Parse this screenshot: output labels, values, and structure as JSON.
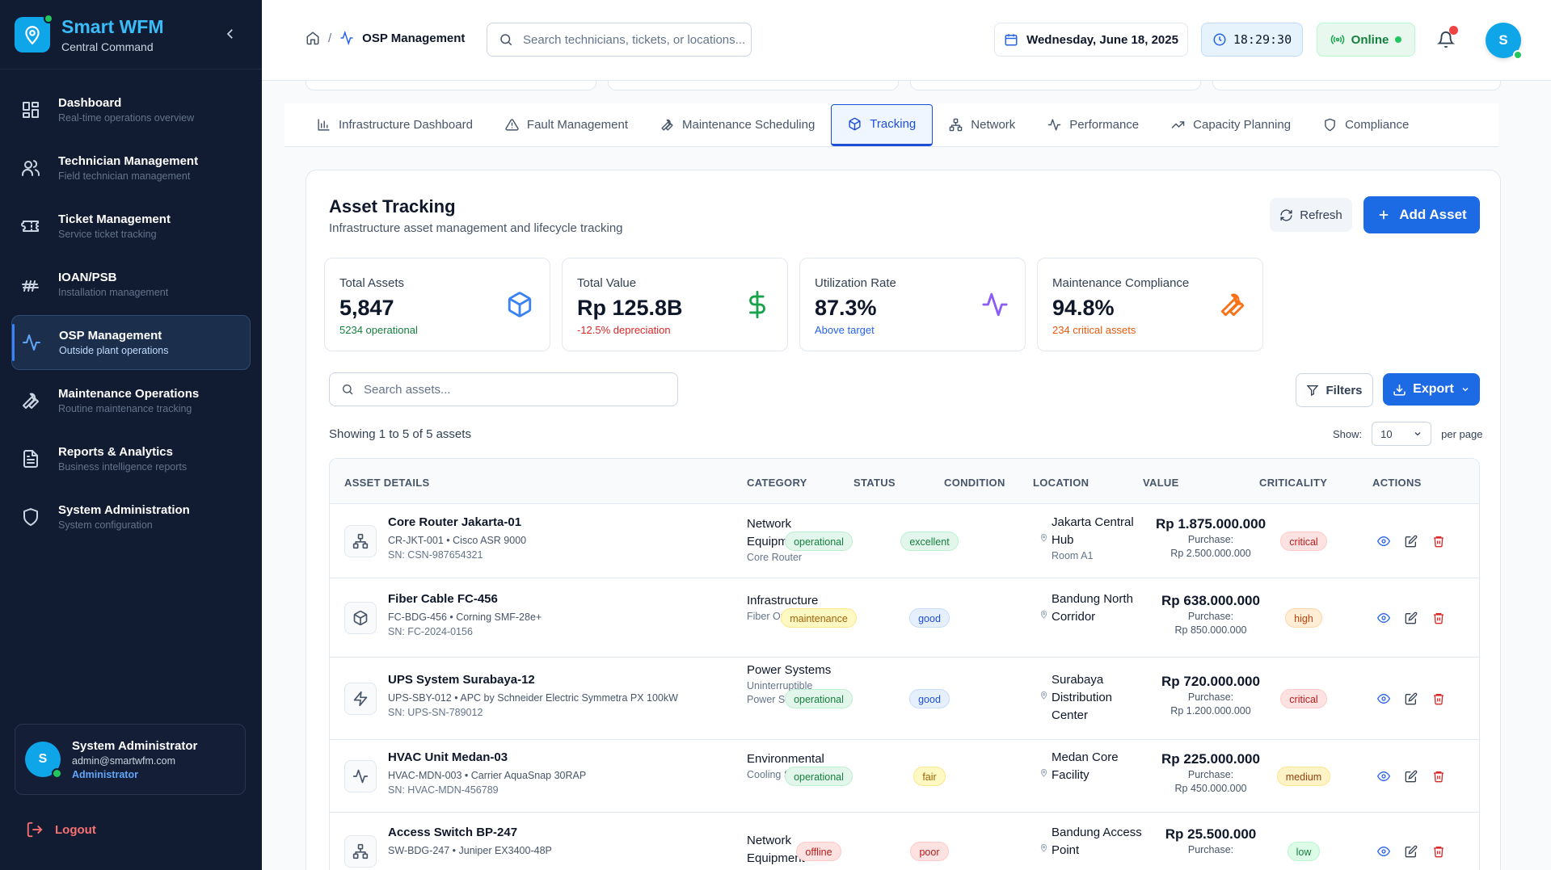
{
  "sidebar": {
    "brand_title": "Smart WFM",
    "brand_subtitle": "Central Command",
    "items": [
      {
        "label": "Dashboard",
        "sub": "Real-time operations overview",
        "icon": "dashboard-icon"
      },
      {
        "label": "Technician Management",
        "sub": "Field technician management",
        "icon": "users-icon"
      },
      {
        "label": "Ticket Management",
        "sub": "Service ticket tracking",
        "icon": "ticket-icon"
      },
      {
        "label": "IOAN/PSB",
        "sub": "Installation management",
        "icon": "signal-icon"
      },
      {
        "label": "OSP Management",
        "sub": "Outside plant operations",
        "icon": "activity-icon",
        "active": true
      },
      {
        "label": "Maintenance Operations",
        "sub": "Routine maintenance tracking",
        "icon": "wrench-icon"
      },
      {
        "label": "Reports & Analytics",
        "sub": "Business intelligence reports",
        "icon": "report-icon"
      },
      {
        "label": "System Administration",
        "sub": "System configuration",
        "icon": "shield-icon"
      }
    ],
    "user": {
      "initial": "S",
      "name": "System Administrator",
      "email": "admin@smartwfm.com",
      "role": "Administrator"
    },
    "logout_label": "Logout"
  },
  "header": {
    "breadcrumb_sep": "/",
    "breadcrumb_current": "OSP Management",
    "search_placeholder": "Search technicians, tickets, or locations...",
    "date": "Wednesday, June 18, 2025",
    "time": "18:29:30",
    "status": "Online",
    "avatar_initial": "S"
  },
  "tabs": [
    {
      "label": "Infrastructure Dashboard",
      "icon": "bar-chart-icon"
    },
    {
      "label": "Fault Management",
      "icon": "warning-icon"
    },
    {
      "label": "Maintenance Scheduling",
      "icon": "wrench-icon"
    },
    {
      "label": "Tracking",
      "icon": "package-icon",
      "active": true
    },
    {
      "label": "Network",
      "icon": "network-icon"
    },
    {
      "label": "Performance",
      "icon": "activity-icon"
    },
    {
      "label": "Capacity Planning",
      "icon": "trending-up-icon"
    },
    {
      "label": "Compliance",
      "icon": "shield-icon"
    }
  ],
  "panel": {
    "title": "Asset Tracking",
    "subtitle": "Infrastructure asset management and lifecycle tracking",
    "refresh_label": "Refresh",
    "add_label": "Add Asset",
    "search_placeholder": "Search assets...",
    "filters_label": "Filters",
    "export_label": "Export",
    "showing_text": "Showing 1 to 5 of 5 assets",
    "show_label": "Show:",
    "page_size": "10",
    "per_page_label": "per page"
  },
  "stats": [
    {
      "label": "Total Assets",
      "value": "5,847",
      "note": "5234 operational",
      "note_color": "#15803d",
      "icon": "package-icon",
      "icon_color": "#3b82f6"
    },
    {
      "label": "Total Value",
      "value": "Rp 125.8B",
      "note": "-12.5% depreciation",
      "note_color": "#dc2626",
      "icon": "dollar-icon",
      "icon_color": "#16a34a"
    },
    {
      "label": "Utilization Rate",
      "value": "87.3%",
      "note": "Above target",
      "note_color": "#2563eb",
      "icon": "activity-icon",
      "icon_color": "#8b5cf6"
    },
    {
      "label": "Maintenance Compliance",
      "value": "94.8%",
      "note": "234 critical assets",
      "note_color": "#ea580c",
      "icon": "wrench-icon",
      "icon_color": "#f97316"
    }
  ],
  "table": {
    "columns": [
      "ASSET DETAILS",
      "CATEGORY",
      "STATUS",
      "CONDITION",
      "LOCATION",
      "VALUE",
      "CRITICALITY",
      "ACTIONS"
    ],
    "rows": [
      {
        "icon": "network-icon",
        "name": "Core Router Jakarta-01",
        "model": "CR-JKT-001 • Cisco ASR 9000",
        "sn": "SN: CSN-987654321",
        "category": "Network Equipment",
        "category_sub": "Core Router",
        "status": "operational",
        "condition": "excellent",
        "location": "Jakarta Central Hub",
        "location_sub": "Room A1",
        "value": "Rp 1.875.000.000",
        "purchase_label": "Purchase:",
        "purchase": "Rp 2.500.000.000",
        "criticality": "critical"
      },
      {
        "icon": "package-icon",
        "name": "Fiber Cable FC-456",
        "model": "FC-BDG-456 • Corning SMF-28e+",
        "sn": "SN: FC-2024-0156",
        "category": "Infrastructure",
        "category_sub": "Fiber Optic Cable",
        "status": "maintenance",
        "condition": "good",
        "location": "Bandung North Corridor",
        "location_sub": "",
        "value": "Rp 638.000.000",
        "purchase_label": "Purchase:",
        "purchase": "Rp 850.000.000",
        "criticality": "high"
      },
      {
        "icon": "zap-icon",
        "name": "UPS System Surabaya-12",
        "model": "UPS-SBY-012 • APC by Schneider Electric Symmetra PX 100kW",
        "sn": "SN: UPS-SN-789012",
        "category": "Power Systems",
        "category_sub": "Uninterruptible Power Supply",
        "status": "operational",
        "condition": "good",
        "location": "Surabaya Distribution Center",
        "location_sub": "",
        "value": "Rp 720.000.000",
        "purchase_label": "Purchase:",
        "purchase": "Rp 1.200.000.000",
        "criticality": "critical"
      },
      {
        "icon": "activity-icon",
        "name": "HVAC Unit Medan-03",
        "model": "HVAC-MDN-003 • Carrier AquaSnap 30RAP",
        "sn": "SN: HVAC-MDN-456789",
        "category": "Environmental",
        "category_sub": "Cooling System",
        "status": "operational",
        "condition": "fair",
        "location": "Medan Core Facility",
        "location_sub": "",
        "value": "Rp 225.000.000",
        "purchase_label": "Purchase:",
        "purchase": "Rp 450.000.000",
        "criticality": "medium"
      },
      {
        "icon": "network-icon",
        "name": "Access Switch BP-247",
        "model": "SW-BDG-247 • Juniper EX3400-48P",
        "sn": "",
        "category": "Network Equipment",
        "category_sub": "",
        "status": "offline",
        "condition": "poor",
        "location": "Bandung Access Point",
        "location_sub": "",
        "value": "Rp 25.500.000",
        "purchase_label": "Purchase:",
        "purchase": "",
        "criticality": "low"
      }
    ]
  }
}
